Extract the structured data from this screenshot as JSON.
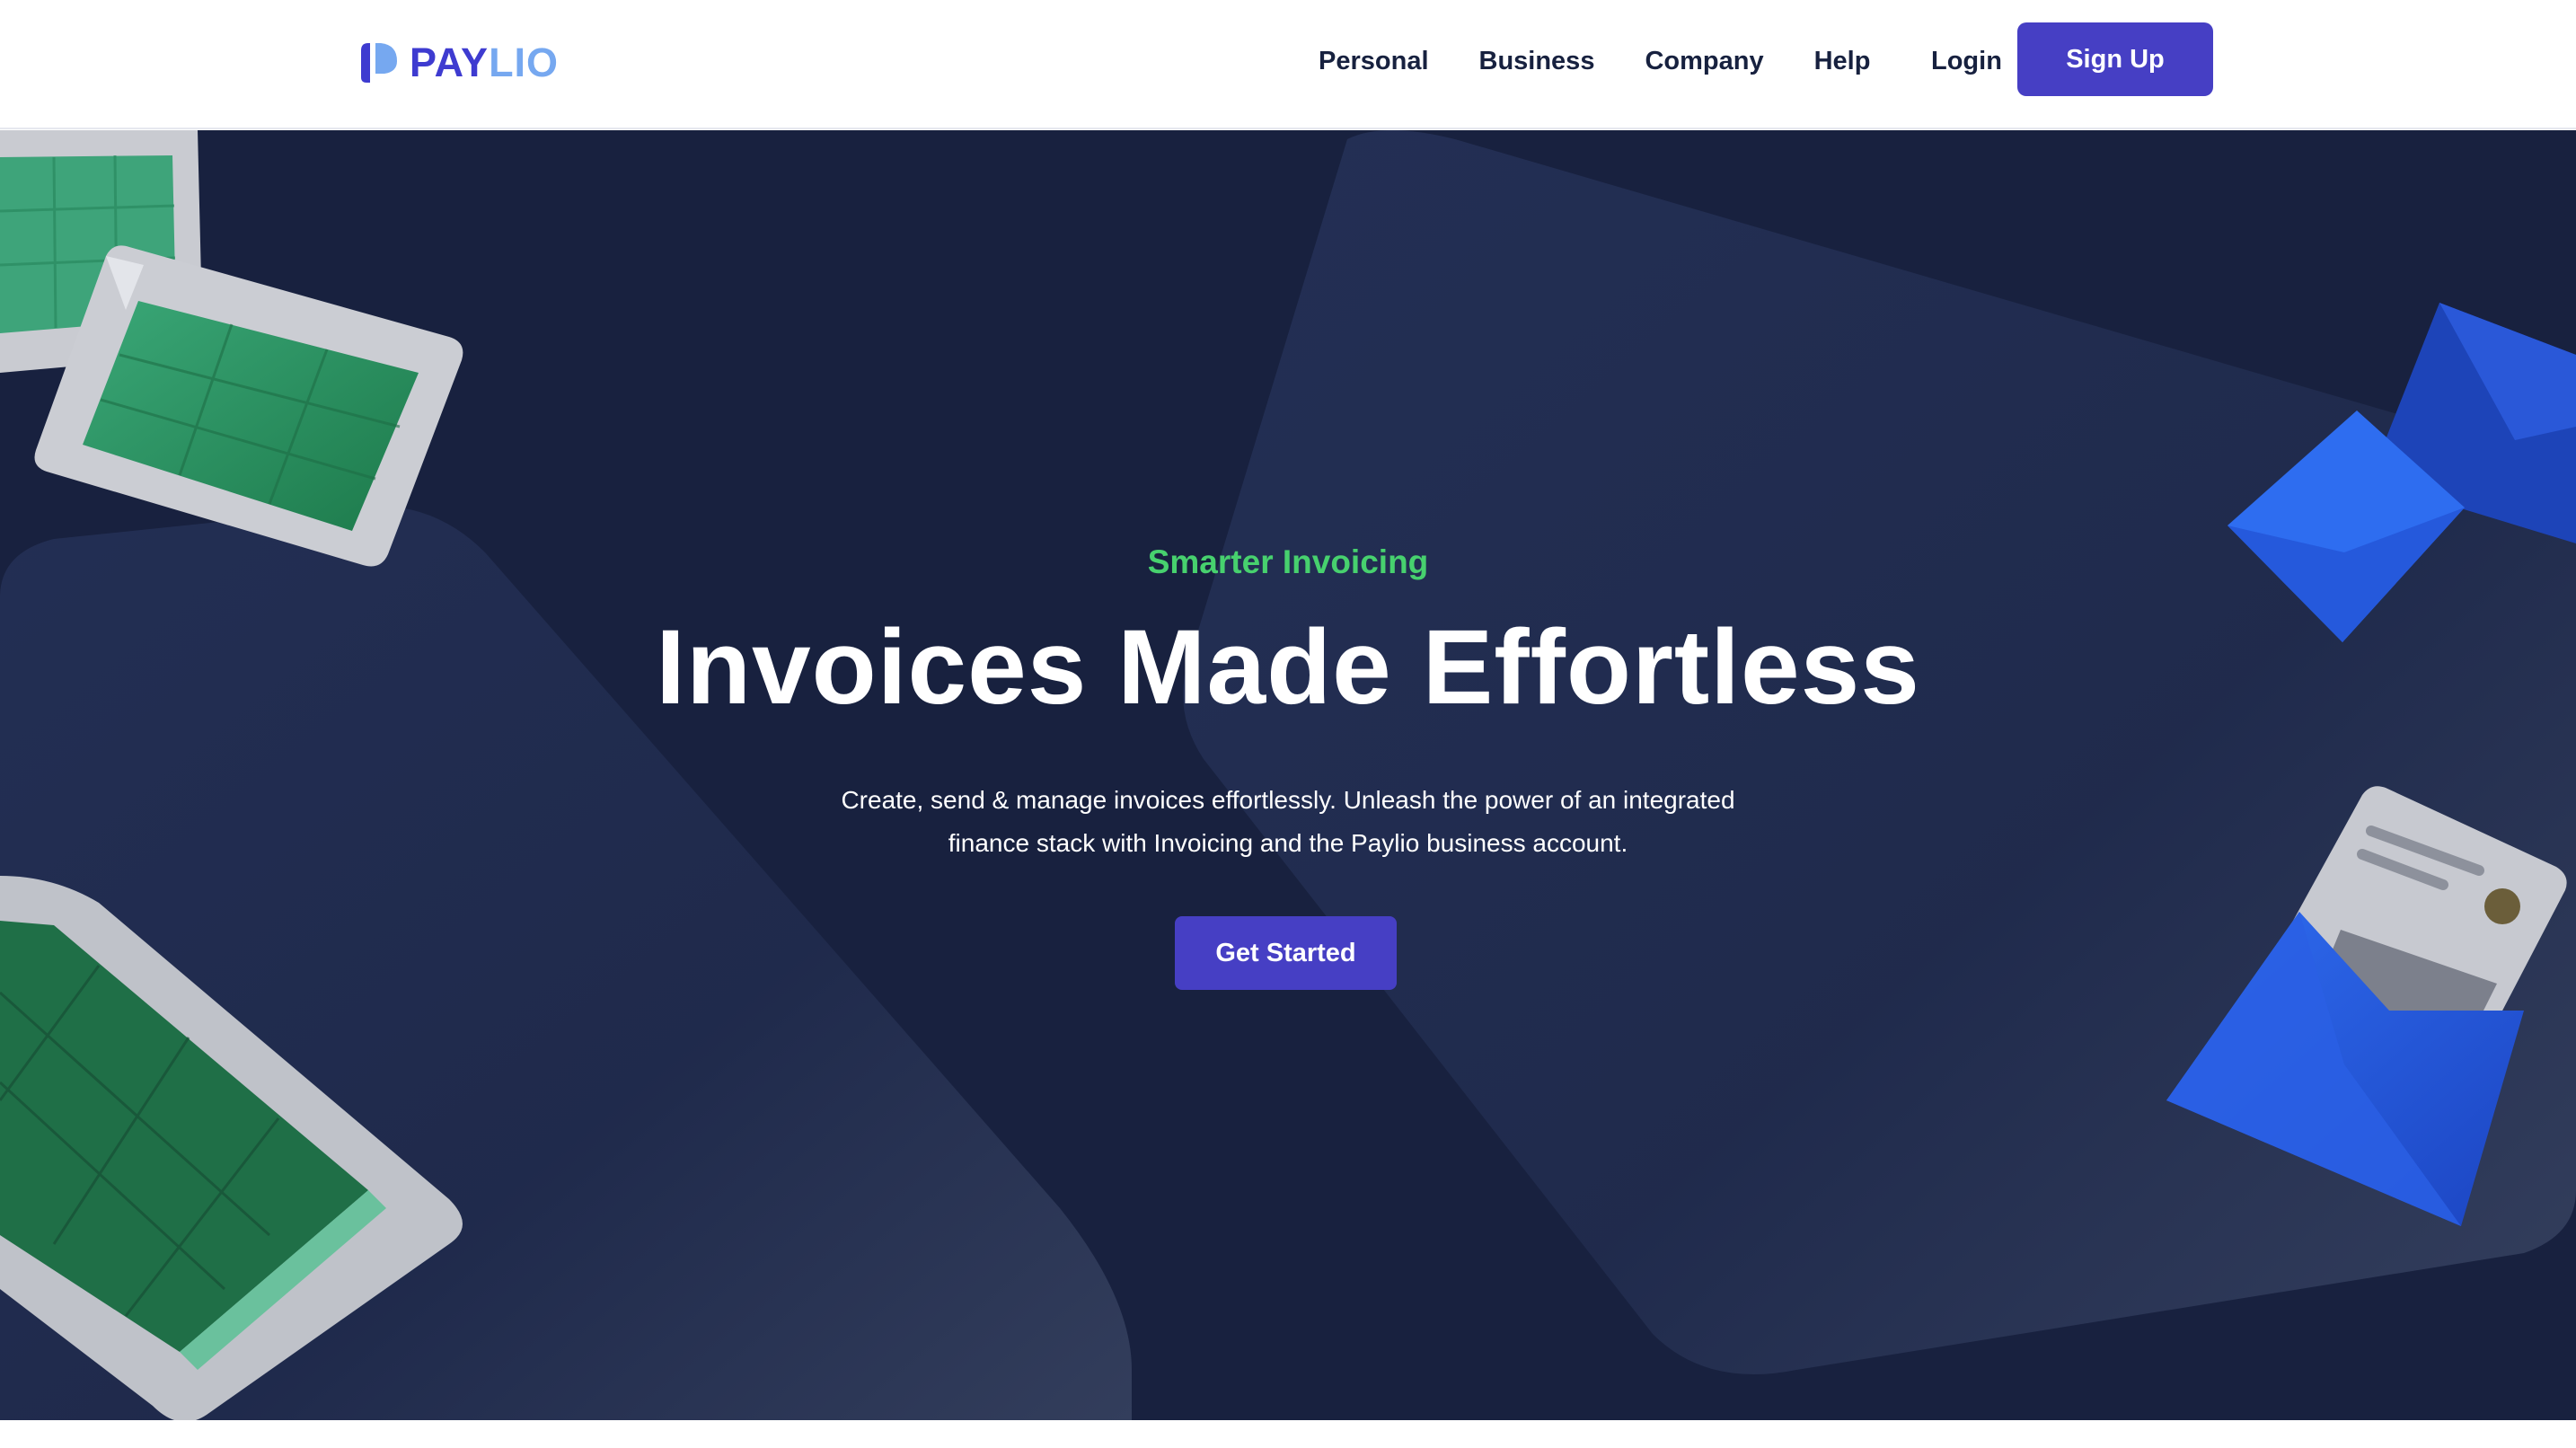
{
  "brand": {
    "name_part1": "PAY",
    "name_part2": "LIO",
    "primary_color": "#3e3bd0",
    "secondary_color": "#76a8f0"
  },
  "nav": {
    "items": [
      {
        "label": "Personal"
      },
      {
        "label": "Business"
      },
      {
        "label": "Company"
      },
      {
        "label": "Help"
      }
    ],
    "login_label": "Login",
    "signup_label": "Sign Up"
  },
  "hero": {
    "eyebrow": "Smarter Invoicing",
    "headline": "Invoices Made Effortless",
    "subtitle": "Create, send & manage invoices effortlessly. Unleash the power of an integrated finance stack with Invoicing and the Paylio business account.",
    "cta_label": "Get Started",
    "background_color": "#18213f",
    "accent_color": "#47d16e",
    "button_color": "#463fc4"
  },
  "decorations": {
    "left": [
      "spreadsheet-card-icon",
      "spreadsheet-card-icon",
      "spreadsheet-card-icon"
    ],
    "right": [
      "envelope-icon",
      "envelope-icon",
      "envelope-with-invoice-icon"
    ]
  }
}
